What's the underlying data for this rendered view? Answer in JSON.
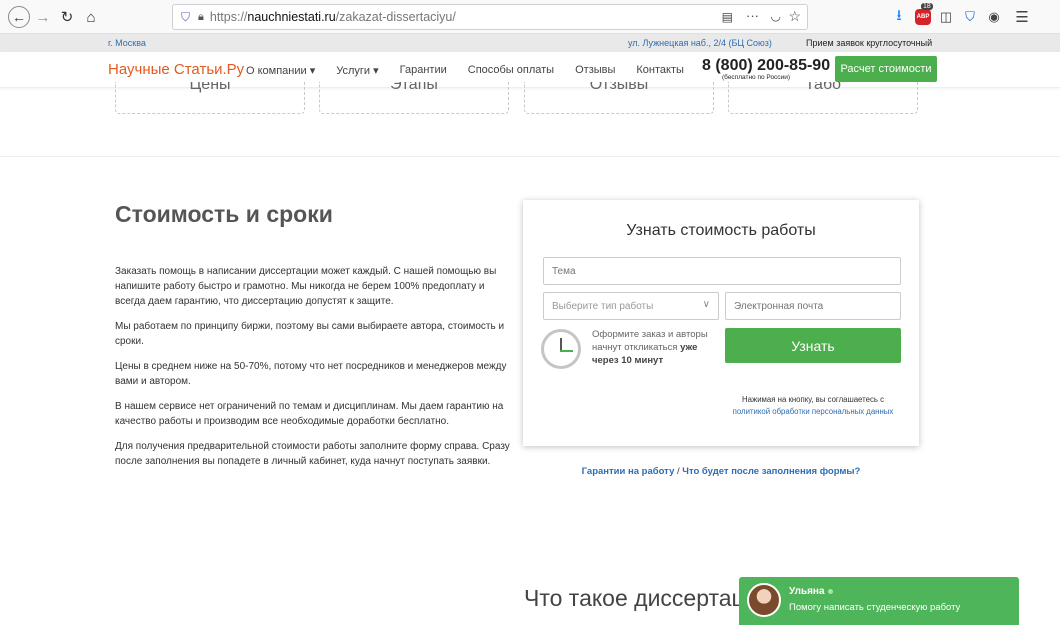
{
  "browser": {
    "url_scheme": "https://",
    "url_host": "nauchniestati.ru",
    "url_path": "/zakazat-dissertaciyu/",
    "abp_count": "18",
    "abp_label": "ABP"
  },
  "infobar": {
    "city": "г. Москва",
    "address": "ул. Лужнецкая наб., 2/4 (БЦ Союз)",
    "hours": "Прием заявок круглосуточный"
  },
  "header": {
    "logo": "Научные Статьи.Ру",
    "menu": [
      "О компании ▾",
      "Услуги ▾",
      "Гарантии",
      "Способы оплаты",
      "Отзывы",
      "Контакты"
    ],
    "phone": "8 (800) 200-85-90",
    "phone_note": "(бесплатно по России)",
    "cta": "Расчет стоимости"
  },
  "dashed_boxes": [
    "Цены",
    "Этапы",
    "Отзывы",
    "Табо"
  ],
  "content": {
    "title": "Стоимость и сроки",
    "paragraphs": [
      "Заказать помощь в написании диссертации может каждый. С нашей помощью вы напишите работу быстро и грамотно. Мы никогда не берем 100% предоплату и всегда даем гарантию, что диссертацию допустят к защите.",
      "Мы работаем по принципу биржи, поэтому вы сами выбираете автора, стоимость и сроки.",
      "Цены в среднем ниже на 50-70%, потому что нет посредников и менеджеров между вами и автором.",
      "В нашем сервисе нет ограничений по темам и дисциплинам. Мы даем гарантию на качество работы и производим все необходимые доработки бесплатно.",
      "Для получения предварительной стоимости работы заполните форму справа. Сразу после заполнения вы попадете в личный кабинет, куда начнут поступать заявки."
    ]
  },
  "form": {
    "title": "Узнать стоимость работы",
    "topic_placeholder": "Тема",
    "worktype_placeholder": "Выберите тип работы",
    "email_placeholder": "Электронная почта",
    "hint_text": "Оформите заказ и авторы начнут откликаться",
    "hint_bold": "уже через 10 минут",
    "submit": "Узнать",
    "consent_text": "Нажимая на кнопку, вы соглашаетесь с",
    "consent_link": "политикой обработки персональных данных"
  },
  "links": {
    "guarantee": "Гарантии на работу",
    "separator": "/",
    "after_form": "Что будет после заполнения формы?"
  },
  "bottom_title": "Что такое диссертация",
  "chat": {
    "name": "Ульяна",
    "message": "Помогу написать студенческую работу"
  }
}
